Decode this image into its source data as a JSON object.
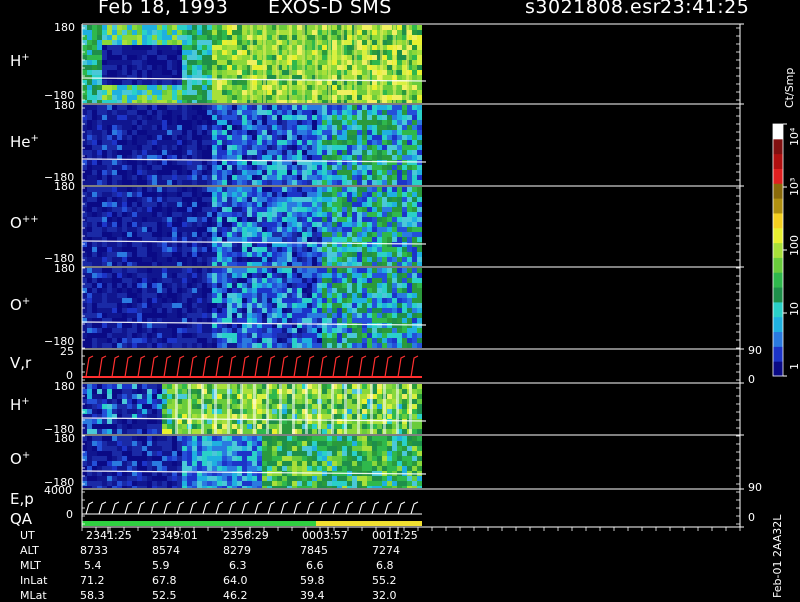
{
  "header": {
    "date": "Feb 18, 1993",
    "instrument": "EXOS-D SMS",
    "file": "s3021808.esr",
    "time": "23:41:25"
  },
  "panels": [
    {
      "id": "h1",
      "species": "H",
      "charge": "+",
      "top_tick": "180",
      "bottom_tick": "−180"
    },
    {
      "id": "he",
      "species": "He",
      "charge": "+",
      "top_tick": "180",
      "bottom_tick": "−180"
    },
    {
      "id": "opp",
      "species": "O",
      "charge": "++",
      "top_tick": "180",
      "bottom_tick": "−180"
    },
    {
      "id": "o1",
      "species": "O",
      "charge": "+",
      "top_tick": "180",
      "bottom_tick": "−180"
    },
    {
      "id": "vr",
      "species": "V,r",
      "charge": "",
      "top_tick": "25",
      "bottom_tick": "0",
      "right_top": "90",
      "right_bottom": "0"
    },
    {
      "id": "h2",
      "species": "H",
      "charge": "+",
      "top_tick": "180",
      "bottom_tick": "−180"
    },
    {
      "id": "o2",
      "species": "O",
      "charge": "+",
      "top_tick": "180",
      "bottom_tick": "−180"
    },
    {
      "id": "ep",
      "species": "E,p",
      "charge": "",
      "top_tick": "4000",
      "bottom_tick": "0",
      "right_top": "90",
      "right_bottom": "0"
    }
  ],
  "qa_label": "QA",
  "colorbar": {
    "title": "Ct/Smp",
    "labels": [
      {
        "text": "1",
        "value": 1
      },
      {
        "text": "10",
        "value": 10
      },
      {
        "text": "100",
        "value": 100
      },
      {
        "text": "10³",
        "value": 1000
      },
      {
        "text": "10⁴",
        "value": 10000
      }
    ],
    "colors": [
      "#0a0a85",
      "#1c34c8",
      "#2a7ae0",
      "#1fb0e0",
      "#2ad0c8",
      "#1e8f4a",
      "#2fb84c",
      "#6acc3c",
      "#a8e03a",
      "#e8f030",
      "#f5d020",
      "#b09010",
      "#8a6a0a",
      "#e02020",
      "#b01010",
      "#801010",
      "#ffffff"
    ]
  },
  "ephemeris": {
    "rows": [
      {
        "label": "UT",
        "values": [
          "2341:25",
          "2349:01",
          "2356:29",
          "0003:57",
          "0011:25"
        ]
      },
      {
        "label": "ALT",
        "values": [
          "8733",
          "8574",
          "8279",
          "7845",
          "7274"
        ]
      },
      {
        "label": "MLT",
        "values": [
          "5.4",
          "5.9",
          "6.3",
          "6.6",
          "6.8"
        ]
      },
      {
        "label": "InLat",
        "values": [
          "71.2",
          "67.8",
          "64.0",
          "59.8",
          "55.2"
        ]
      },
      {
        "label": "MLat",
        "values": [
          "58.3",
          "52.5",
          "46.2",
          "39.4",
          "32.0"
        ]
      }
    ]
  },
  "footer_id": "Feb-01 2AA32L",
  "chart_data": {
    "type": "heatmap",
    "title": "Feb 18, 1993   EXOS-D SMS",
    "x": [
      "2341:25",
      "2349:01",
      "2356:29",
      "0003:57",
      "0011:25"
    ],
    "color_scale": "log",
    "zlabel": "Ct/Smp",
    "zlim": [
      1,
      10000
    ],
    "series": [
      {
        "name": "H+",
        "ylim": [
          -180,
          180
        ]
      },
      {
        "name": "He+",
        "ylim": [
          -180,
          180
        ]
      },
      {
        "name": "O++",
        "ylim": [
          -180,
          180
        ]
      },
      {
        "name": "O+",
        "ylim": [
          -180,
          180
        ]
      },
      {
        "name": "V,r",
        "ylim": [
          0,
          25
        ],
        "right_ylim": [
          0,
          90
        ]
      },
      {
        "name": "H+",
        "ylim": [
          -180,
          180
        ]
      },
      {
        "name": "O+",
        "ylim": [
          -180,
          180
        ]
      },
      {
        "name": "E,p",
        "ylim": [
          0,
          4000
        ],
        "right_ylim": [
          0,
          90
        ]
      }
    ]
  }
}
